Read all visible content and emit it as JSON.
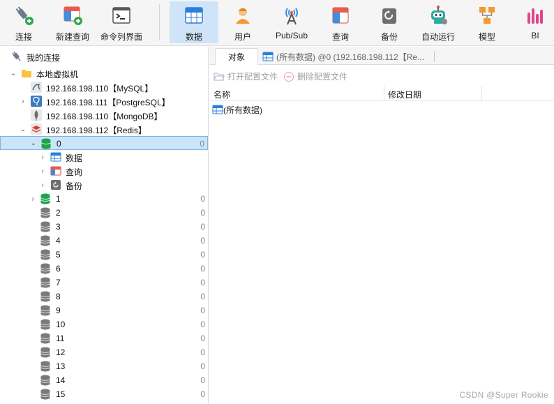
{
  "toolbar": {
    "buttons": [
      {
        "label": "连接",
        "icon": "plug-add-icon"
      },
      {
        "label": "新建查询",
        "icon": "new-query-icon"
      },
      {
        "label": "命令列界面",
        "icon": "terminal-icon"
      },
      {
        "label": "数据",
        "icon": "data-table-icon",
        "active": true
      },
      {
        "label": "用户",
        "icon": "user-icon"
      },
      {
        "label": "Pub/Sub",
        "icon": "broadcast-tower-icon"
      },
      {
        "label": "查询",
        "icon": "query-icon"
      },
      {
        "label": "备份",
        "icon": "backup-icon"
      },
      {
        "label": "自动运行",
        "icon": "robot-icon"
      },
      {
        "label": "模型",
        "icon": "model-icon"
      },
      {
        "label": "BI",
        "icon": "bi-chart-icon"
      }
    ]
  },
  "tree": {
    "root_label": "我的连接",
    "group_label": "本地虚拟机",
    "connections": [
      {
        "label": "192.168.198.110【MySQL】",
        "type": "mysql",
        "expanded": false,
        "has_chevron": false
      },
      {
        "label": "192.168.198.111【PostgreSQL】",
        "type": "postgresql",
        "expanded": false,
        "has_chevron": true
      },
      {
        "label": "192.168.198.110【MongoDB】",
        "type": "mongodb",
        "expanded": false,
        "has_chevron": false
      },
      {
        "label": "192.168.198.112【Redis】",
        "type": "redis",
        "expanded": true,
        "has_chevron": true
      }
    ],
    "db0": {
      "label": "0",
      "count": "0"
    },
    "db0_children": [
      {
        "label": "数据",
        "icon": "data-table-icon"
      },
      {
        "label": "查询",
        "icon": "query-icon"
      },
      {
        "label": "备份",
        "icon": "backup-icon"
      }
    ],
    "databases": [
      {
        "label": "1",
        "count": "0",
        "green": true,
        "chevron": true
      },
      {
        "label": "2",
        "count": "0"
      },
      {
        "label": "3",
        "count": "0"
      },
      {
        "label": "4",
        "count": "0"
      },
      {
        "label": "5",
        "count": "0"
      },
      {
        "label": "6",
        "count": "0"
      },
      {
        "label": "7",
        "count": "0"
      },
      {
        "label": "8",
        "count": "0"
      },
      {
        "label": "9",
        "count": "0"
      },
      {
        "label": "10",
        "count": "0"
      },
      {
        "label": "11",
        "count": "0"
      },
      {
        "label": "12",
        "count": "0"
      },
      {
        "label": "13",
        "count": "0"
      },
      {
        "label": "14",
        "count": "0"
      },
      {
        "label": "15",
        "count": "0"
      }
    ]
  },
  "right": {
    "tab_objects": "对象",
    "tab_data": "(所有数据) @0 (192.168.198.112【Re...",
    "open_profile": "打开配置文件",
    "delete_profile": "删除配置文件",
    "col_name": "名称",
    "col_modified": "修改日期",
    "row_item": "(所有数据)"
  },
  "watermark": "CSDN @Super Rookie",
  "colors": {
    "accent": "#1e7fd6",
    "active_bg": "#cfe4f8",
    "selected_bg": "#cce4f7",
    "redis_green": "#1ea34a",
    "db_gray": "#7a7a7a"
  }
}
